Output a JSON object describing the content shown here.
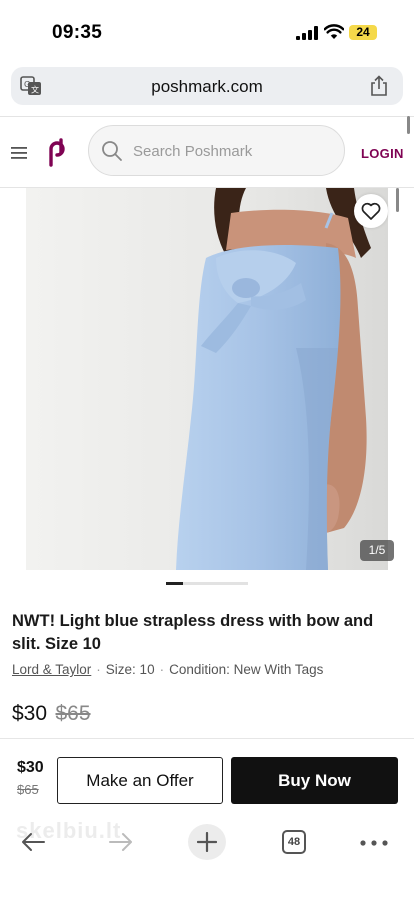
{
  "status_bar": {
    "time": "09:35",
    "battery": "24"
  },
  "url_bar": {
    "domain": "poshmark.com"
  },
  "header": {
    "search_placeholder": "Search Poshmark",
    "login_label": "LOGIN"
  },
  "product": {
    "image_counter": "1/5",
    "title": "NWT! Light blue strapless dress with bow and slit. Size 10",
    "brand": "Lord & Taylor",
    "size": "Size: 10",
    "condition": "Condition: New With Tags",
    "price": "$30",
    "original_price": "$65"
  },
  "buy_bar": {
    "price": "$30",
    "original_price": "$65",
    "offer_label": "Make an Offer",
    "buy_label": "Buy Now"
  },
  "toolbar": {
    "tab_count": "48",
    "watermark": "skelbiu.lt"
  },
  "colors": {
    "brand": "#7f0353",
    "dress": "#a9c6e6",
    "battery": "#f5d94a"
  },
  "icons": [
    "translate-icon",
    "share-icon",
    "menu-icon",
    "poshmark-logo-icon",
    "search-icon",
    "heart-icon",
    "back-icon",
    "forward-icon",
    "plus-icon",
    "more-icon"
  ]
}
